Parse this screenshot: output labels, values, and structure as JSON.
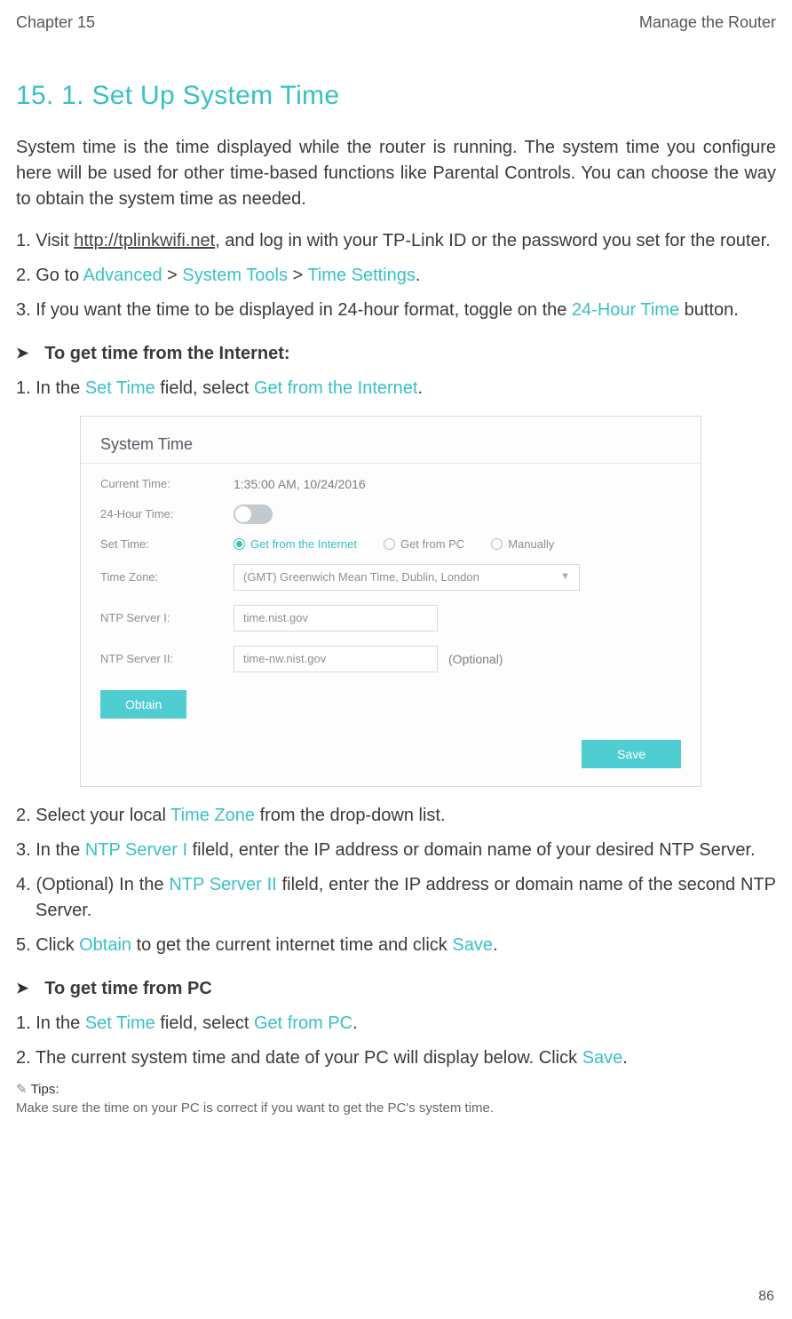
{
  "header": {
    "left": "Chapter 15",
    "right": "Manage the Router"
  },
  "title": "15. 1.   Set Up System Time",
  "intro": "System time is the time displayed while the router is running. The system time you configure here will be used for other time-based functions like Parental Controls. You can choose the  way to obtain the system time as needed.",
  "steps_a": {
    "s1_pre": "1. Visit ",
    "s1_link": "http://tplinkwifi.net",
    "s1_post": ", and log in with your TP-Link ID or the password you set for the router.",
    "s2_pre": "2. Go to ",
    "s2_a": "Advanced",
    "s2_m1": " > ",
    "s2_b": "System Tools",
    "s2_m2": " > ",
    "s2_c": "Time Settings",
    "s2_post": ".",
    "s3_pre": "3. If you want the time to be displayed in 24-hour format, toggle on the ",
    "s3_a": "24-Hour Time",
    "s3_post": " button."
  },
  "subhead1": "To get time from the Internet:",
  "subhead2": "To get time from PC",
  "steps_b": {
    "s1_pre": "1. In the ",
    "s1_a": "Set Time",
    "s1_mid": " field, select ",
    "s1_b": "Get from the Internet",
    "s1_post": "."
  },
  "card": {
    "title": "System Time",
    "labels": {
      "current": "Current Time:",
      "hour24": "24-Hour Time:",
      "settime": "Set Time:",
      "zone": "Time Zone:",
      "ntp1": "NTP Server I:",
      "ntp2": "NTP Server II:"
    },
    "values": {
      "current": "1:35:00 AM, 10/24/2016",
      "radio1": "Get from the Internet",
      "radio2": "Get from PC",
      "radio3": "Manually",
      "zone": "(GMT) Greenwich Mean Time, Dublin, London",
      "ntp1": "time.nist.gov",
      "ntp2": "time-nw.nist.gov",
      "optional": "(Optional)"
    },
    "buttons": {
      "obtain": "Obtain",
      "save": "Save"
    }
  },
  "steps_c": {
    "s2_pre": "2. Select your local ",
    "s2_a": "Time Zone",
    "s2_post": " from the drop-down list.",
    "s3_pre": "3. In the ",
    "s3_a": "NTP Server I",
    "s3_post": " fileld, enter the IP address or domain name of your desired NTP Server.",
    "s4_pre": "4. (Optional) In the ",
    "s4_a": "NTP Server II",
    "s4_post": " fileld, enter the IP address or domain name of the second NTP Server.",
    "s5_pre": "5. Click ",
    "s5_a": "Obtain",
    "s5_mid": " to get the current internet time and click ",
    "s5_b": "Save",
    "s5_post": "."
  },
  "steps_d": {
    "s1_pre": "1. In the ",
    "s1_a": "Set Time",
    "s1_mid": " field, select ",
    "s1_b": "Get from PC",
    "s1_post": ".",
    "s2_pre": "2. The current system time and date of your PC will display below. Click ",
    "s2_a": "Save",
    "s2_post": "."
  },
  "tips": {
    "label": "Tips:",
    "text": "Make sure the time on your PC is correct if you want to get the PC's system time."
  },
  "page_number": "86"
}
